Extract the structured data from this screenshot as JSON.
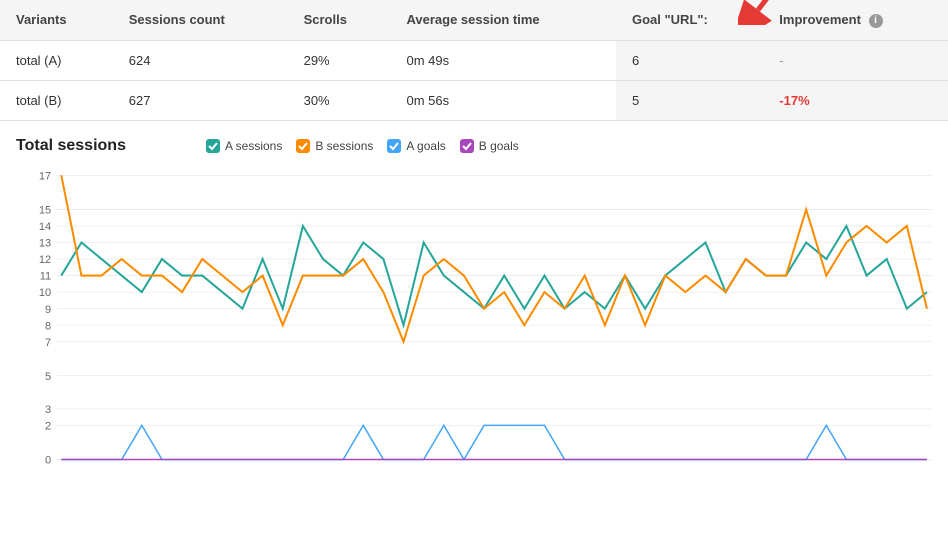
{
  "table": {
    "headers": {
      "variants": "Variants",
      "sessions_count": "Sessions count",
      "scrolls": "Scrolls",
      "avg_session_time": "Average session time",
      "goal_url": "Goal \"URL\":",
      "improvement": "Improvement"
    },
    "rows": [
      {
        "variant": "total (A)",
        "sessions_count": "624",
        "scrolls": "29%",
        "avg_session_time": "0m 49s",
        "goal_url": "6",
        "improvement": "-",
        "improvement_type": "dash"
      },
      {
        "variant": "total (B)",
        "sessions_count": "627",
        "scrolls": "30%",
        "avg_session_time": "0m 56s",
        "goal_url": "5",
        "improvement": "-17%",
        "improvement_type": "negative"
      }
    ]
  },
  "chart": {
    "title": "Total sessions",
    "legend": [
      {
        "label": "A sessions",
        "color": "#26a69a",
        "type": "line"
      },
      {
        "label": "B sessions",
        "color": "#fb8c00",
        "type": "line"
      },
      {
        "label": "A goals",
        "color": "#42a5f5",
        "type": "line"
      },
      {
        "label": "B goals",
        "color": "#ab47bc",
        "type": "line"
      }
    ],
    "y_labels": [
      "0",
      "2",
      "3",
      "5",
      "7",
      "8",
      "9",
      "10",
      "11",
      "12",
      "13",
      "14",
      "15",
      "17"
    ],
    "y_axis": [
      0,
      2,
      3,
      5,
      7,
      8,
      9,
      10,
      11,
      12,
      13,
      14,
      15,
      17
    ]
  }
}
